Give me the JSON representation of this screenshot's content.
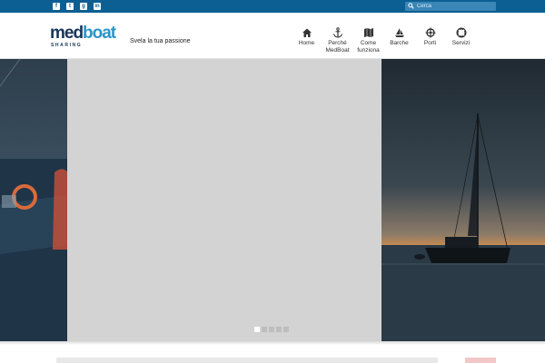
{
  "topbar": {
    "social": [
      {
        "icon": "facebook-icon",
        "glyph": "f"
      },
      {
        "icon": "twitter-icon",
        "glyph": "t"
      },
      {
        "icon": "google-plus-icon",
        "glyph": "g"
      },
      {
        "icon": "linkedin-icon",
        "glyph": "in"
      }
    ],
    "search": {
      "placeholder": "Cerca",
      "icon": "search-icon"
    }
  },
  "header": {
    "logo": {
      "part1": "med",
      "part2": "boat",
      "sub": "SHARING"
    },
    "tagline": "Svela la tua passione",
    "nav": [
      {
        "label": "Home",
        "icon": "home-icon"
      },
      {
        "label": "Perché MedBoat",
        "icon": "anchor-icon"
      },
      {
        "label": "Come funziona",
        "icon": "map-icon"
      },
      {
        "label": "Barche",
        "icon": "sailboat-icon"
      },
      {
        "label": "Porti",
        "icon": "helm-icon"
      },
      {
        "label": "Servizi",
        "icon": "lifebuoy-icon"
      }
    ]
  },
  "slider": {
    "slide_count": 5,
    "active_index": 0
  },
  "colors": {
    "topbar": "#0c5f92",
    "logo_dark": "#16355a",
    "logo_light": "#2a94c8"
  }
}
